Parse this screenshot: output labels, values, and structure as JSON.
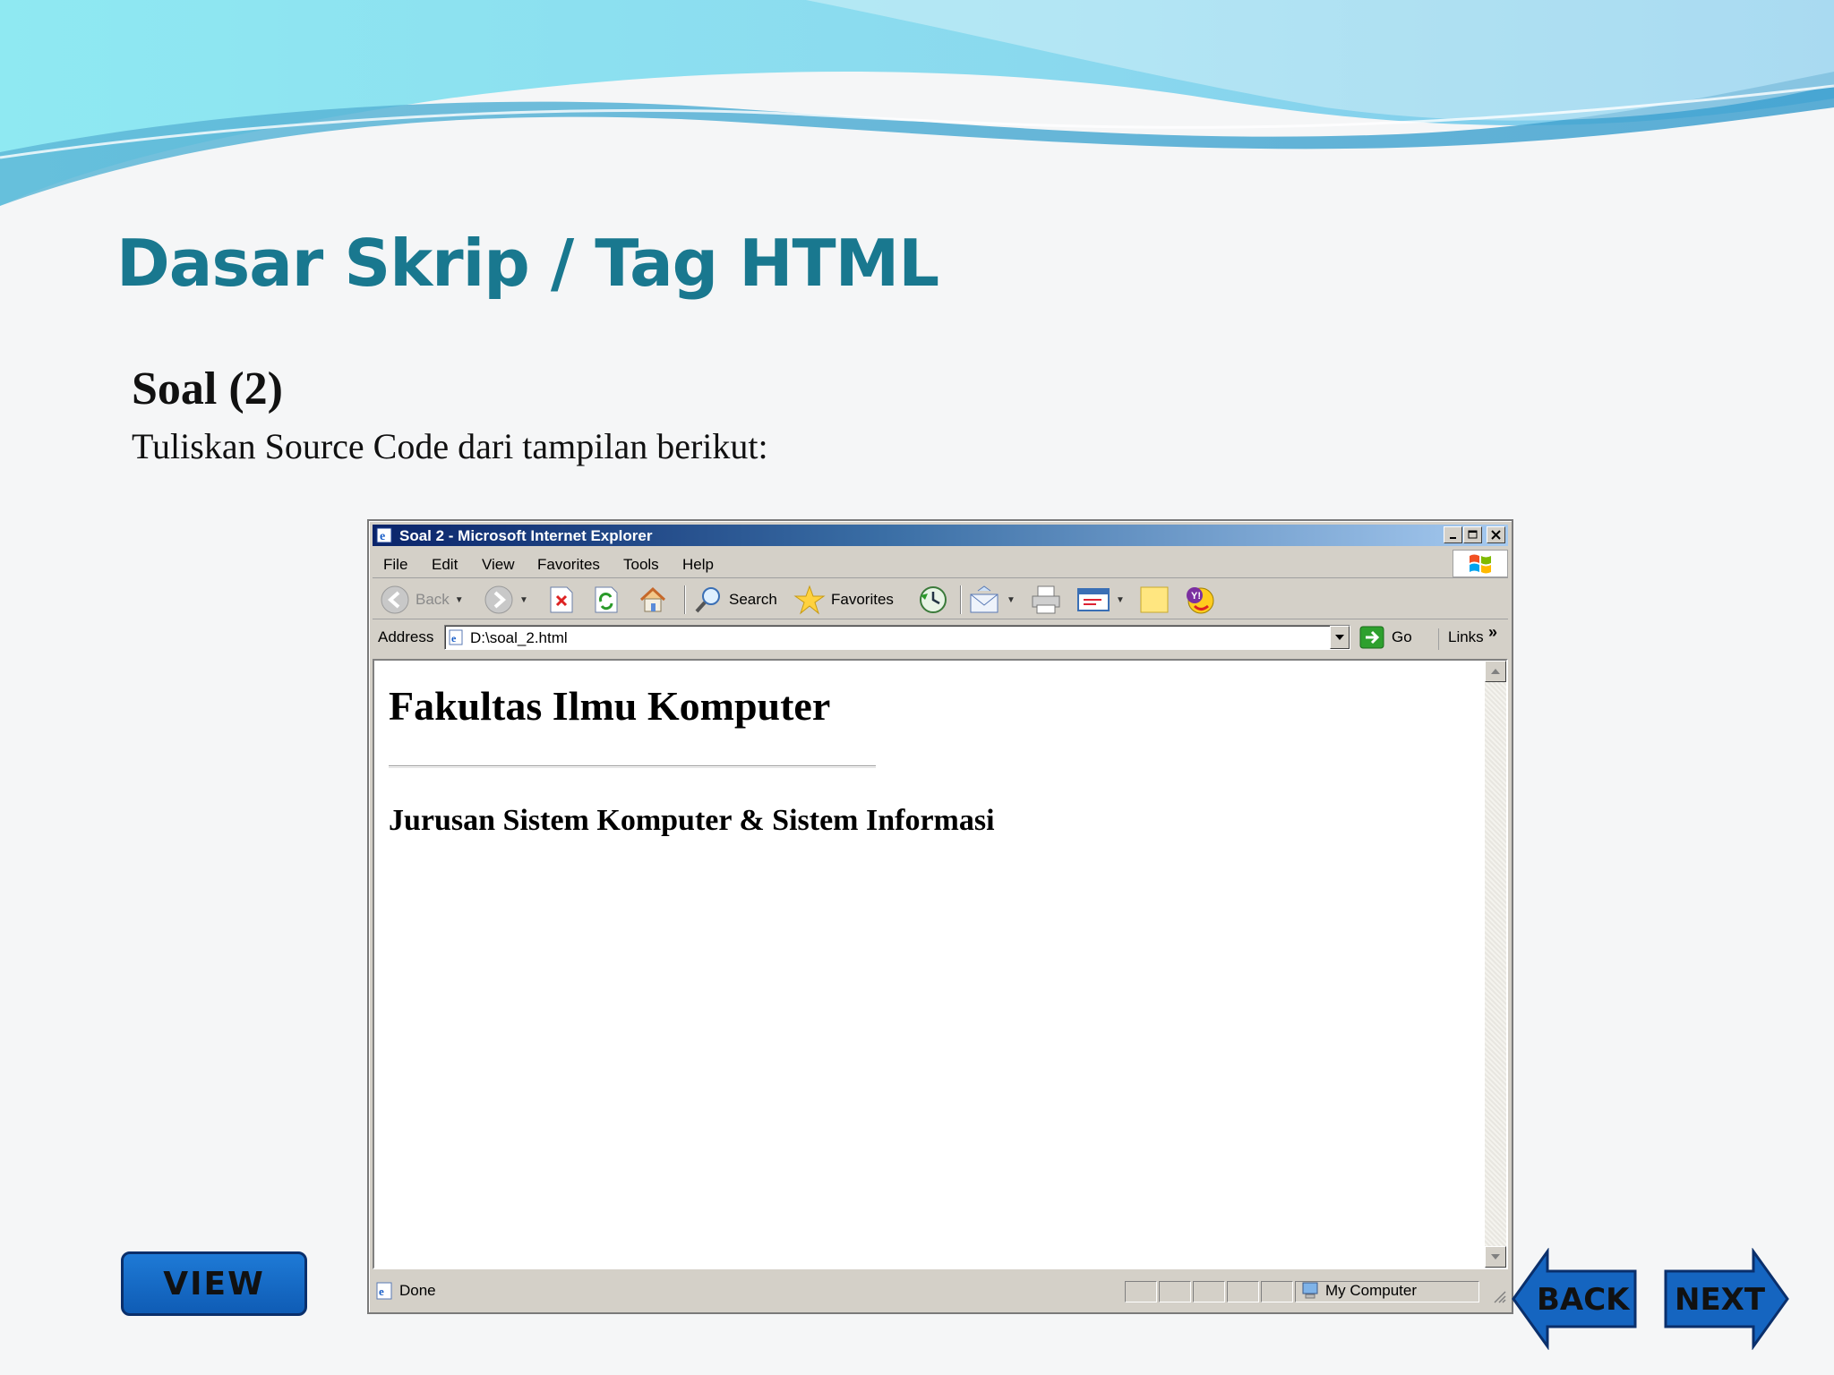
{
  "slide": {
    "title": "Dasar Skrip / Tag HTML",
    "subheading": "Soal (2)",
    "instruction": "Tuliskan Source Code dari tampilan berikut:",
    "colors": {
      "title": "#19788f",
      "wave_light": "#8fe6ef",
      "wave_dark": "#3fa6c9",
      "button": "#1565c0"
    }
  },
  "browser": {
    "window_title": "Soal 2 - Microsoft Internet Explorer",
    "menu": [
      "File",
      "Edit",
      "View",
      "Favorites",
      "Tools",
      "Help"
    ],
    "toolbar": {
      "back": "Back",
      "search": "Search",
      "favorites": "Favorites",
      "icons": [
        "back-icon",
        "forward-icon",
        "stop-icon",
        "refresh-icon",
        "home-icon",
        "search-icon",
        "favorites-star-icon",
        "history-icon",
        "mail-icon",
        "print-icon",
        "edit-icon",
        "discuss-icon",
        "messenger-icon"
      ]
    },
    "address": {
      "label": "Address",
      "value": "D:\\soal_2.html",
      "go": "Go",
      "links": "Links"
    },
    "page": {
      "heading": "Fakultas Ilmu Komputer",
      "subheading": "Jurusan Sistem Komputer & Sistem Informasi"
    },
    "status": {
      "left": "Done",
      "zone": "My Computer"
    }
  },
  "nav": {
    "view": "VIEW",
    "back": "BACK",
    "next": "NEXT"
  }
}
